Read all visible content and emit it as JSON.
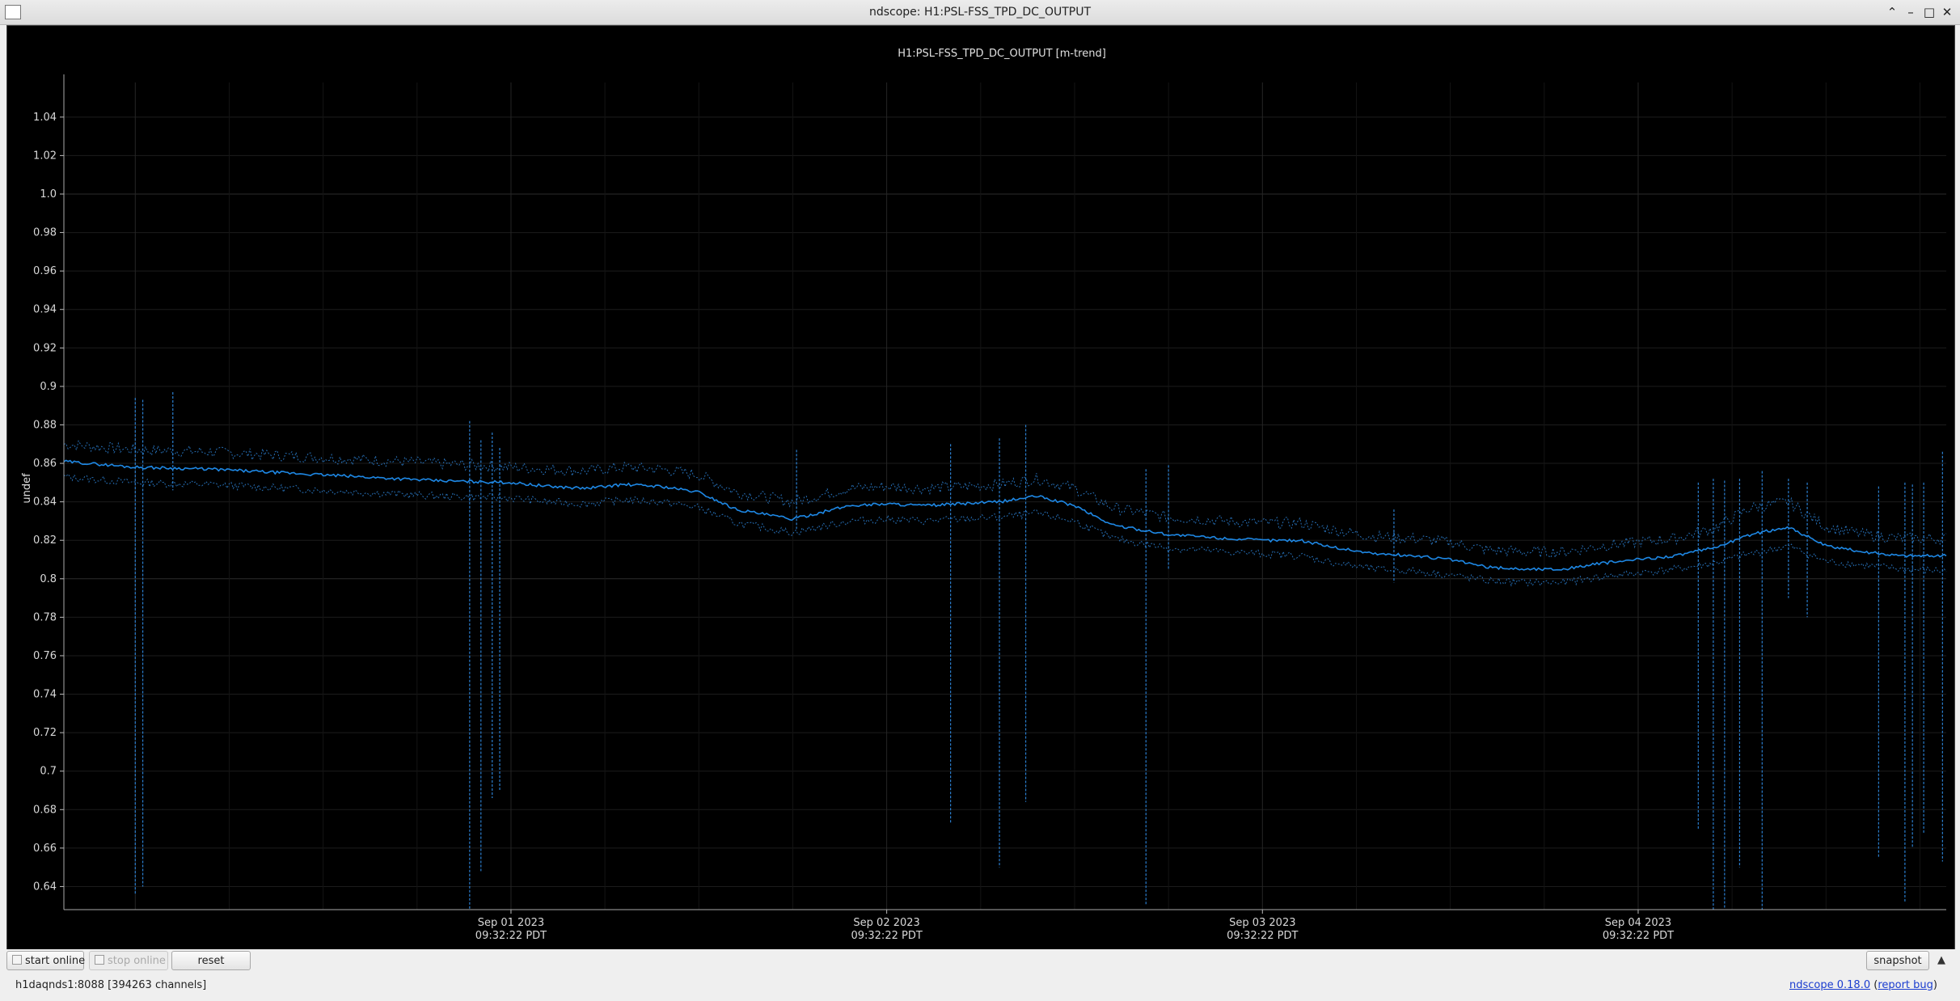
{
  "window": {
    "title": "ndscope: H1:PSL-FSS_TPD_DC_OUTPUT",
    "buttons": [
      "chevron-up-icon",
      "minimize-icon",
      "maximize-icon",
      "close-icon"
    ]
  },
  "colors": {
    "plot_bg": "#000000",
    "trace": "#1e88e5",
    "trace_minmax": "#2b7fd0",
    "grid": "#1c1c1c",
    "axis_text": "#d8d8d8"
  },
  "chart_data": {
    "type": "line",
    "title": "H1:PSL-FSS_TPD_DC_OUTPUT [m-trend]",
    "ylabel": "undef",
    "xlabel": "",
    "ylim": [
      0.628,
      1.058
    ],
    "yticks": [
      "0.64",
      "0.66",
      "0.68",
      "0.7",
      "0.72",
      "0.74",
      "0.76",
      "0.78",
      "0.8",
      "0.82",
      "0.84",
      "0.86",
      "0.88",
      "0.9",
      "0.92",
      "0.94",
      "0.96",
      "0.98",
      "1.0",
      "1.02",
      "1.04"
    ],
    "xlim": [
      -1.19,
      3.82
    ],
    "x_units": "days since Sep 01 2023 09:32:22 PDT",
    "xticks": [
      {
        "x": 0,
        "date": "Sep 01 2023",
        "time": "09:32:22 PDT"
      },
      {
        "x": 1,
        "date": "Sep 02 2023",
        "time": "09:32:22 PDT"
      },
      {
        "x": 2,
        "date": "Sep 03 2023",
        "time": "09:32:22 PDT"
      },
      {
        "x": 3,
        "date": "Sep 04 2023",
        "time": "09:32:22 PDT"
      }
    ],
    "grid": true,
    "series": [
      {
        "name": "mean",
        "x": [
          -1.19,
          -1.0,
          -0.8,
          -0.6,
          -0.4,
          -0.2,
          0.0,
          0.1,
          0.2,
          0.3,
          0.4,
          0.5,
          0.6,
          0.75,
          0.9,
          1.0,
          1.1,
          1.2,
          1.3,
          1.4,
          1.5,
          1.6,
          1.75,
          1.9,
          2.0,
          2.1,
          2.2,
          2.3,
          2.4,
          2.5,
          2.6,
          2.7,
          2.8,
          2.9,
          3.0,
          3.1,
          3.2,
          3.3,
          3.4,
          3.5,
          3.6,
          3.7,
          3.82
        ],
        "values": [
          0.861,
          0.858,
          0.857,
          0.855,
          0.853,
          0.851,
          0.85,
          0.848,
          0.847,
          0.849,
          0.848,
          0.845,
          0.836,
          0.831,
          0.838,
          0.839,
          0.838,
          0.839,
          0.84,
          0.843,
          0.838,
          0.828,
          0.823,
          0.821,
          0.82,
          0.82,
          0.816,
          0.813,
          0.812,
          0.81,
          0.806,
          0.805,
          0.805,
          0.808,
          0.81,
          0.812,
          0.816,
          0.823,
          0.827,
          0.817,
          0.814,
          0.812,
          0.812
        ],
        "min": [
          0.853,
          0.85,
          0.849,
          0.847,
          0.845,
          0.843,
          0.842,
          0.84,
          0.839,
          0.841,
          0.84,
          0.837,
          0.829,
          0.824,
          0.83,
          0.831,
          0.83,
          0.831,
          0.832,
          0.834,
          0.83,
          0.821,
          0.816,
          0.814,
          0.813,
          0.812,
          0.808,
          0.805,
          0.804,
          0.802,
          0.799,
          0.798,
          0.798,
          0.801,
          0.803,
          0.805,
          0.808,
          0.813,
          0.817,
          0.809,
          0.807,
          0.805,
          0.804
        ],
        "max": [
          0.87,
          0.867,
          0.866,
          0.864,
          0.862,
          0.86,
          0.858,
          0.857,
          0.856,
          0.858,
          0.857,
          0.854,
          0.845,
          0.84,
          0.847,
          0.848,
          0.847,
          0.848,
          0.849,
          0.852,
          0.847,
          0.837,
          0.832,
          0.83,
          0.829,
          0.829,
          0.825,
          0.822,
          0.821,
          0.819,
          0.815,
          0.814,
          0.814,
          0.817,
          0.819,
          0.821,
          0.826,
          0.837,
          0.84,
          0.827,
          0.823,
          0.821,
          0.821
        ]
      }
    ],
    "dips": [
      {
        "x": -1.0,
        "min": 0.636,
        "max": 0.894
      },
      {
        "x": -0.98,
        "min": 0.64,
        "max": 0.893
      },
      {
        "x": -0.9,
        "min": 0.846,
        "max": 0.897
      },
      {
        "x": -0.11,
        "min": 0.628,
        "max": 0.882
      },
      {
        "x": -0.08,
        "min": 0.648,
        "max": 0.872
      },
      {
        "x": -0.05,
        "min": 0.686,
        "max": 0.876
      },
      {
        "x": -0.03,
        "min": 0.69,
        "max": 0.868
      },
      {
        "x": 0.76,
        "min": 0.826,
        "max": 0.867
      },
      {
        "x": 1.17,
        "min": 0.673,
        "max": 0.87
      },
      {
        "x": 1.3,
        "min": 0.65,
        "max": 0.873
      },
      {
        "x": 1.37,
        "min": 0.684,
        "max": 0.88
      },
      {
        "x": 1.69,
        "min": 0.63,
        "max": 0.857
      },
      {
        "x": 1.75,
        "min": 0.805,
        "max": 0.859
      },
      {
        "x": 2.35,
        "min": 0.798,
        "max": 0.836
      },
      {
        "x": 3.16,
        "min": 0.67,
        "max": 0.85
      },
      {
        "x": 3.2,
        "min": 0.628,
        "max": 0.852
      },
      {
        "x": 3.23,
        "min": 0.628,
        "max": 0.851
      },
      {
        "x": 3.27,
        "min": 0.65,
        "max": 0.852
      },
      {
        "x": 3.33,
        "min": 0.628,
        "max": 0.856
      },
      {
        "x": 3.4,
        "min": 0.79,
        "max": 0.852
      },
      {
        "x": 3.45,
        "min": 0.78,
        "max": 0.85
      },
      {
        "x": 3.64,
        "min": 0.655,
        "max": 0.848
      },
      {
        "x": 3.71,
        "min": 0.632,
        "max": 0.85
      },
      {
        "x": 3.73,
        "min": 0.66,
        "max": 0.849
      },
      {
        "x": 3.76,
        "min": 0.668,
        "max": 0.85
      },
      {
        "x": 3.81,
        "min": 0.653,
        "max": 0.866
      }
    ]
  },
  "toolbar": {
    "start_online": "start online",
    "stop_online": "stop online",
    "reset": "reset",
    "snapshot": "snapshot",
    "collapse_icon": "▲"
  },
  "status": {
    "server": "h1daqnds1:8088  [394263 channels]",
    "version_link": "ndscope 0.18.0",
    "paren_open": " (",
    "bug_link": "report bug",
    "paren_close": ")"
  }
}
